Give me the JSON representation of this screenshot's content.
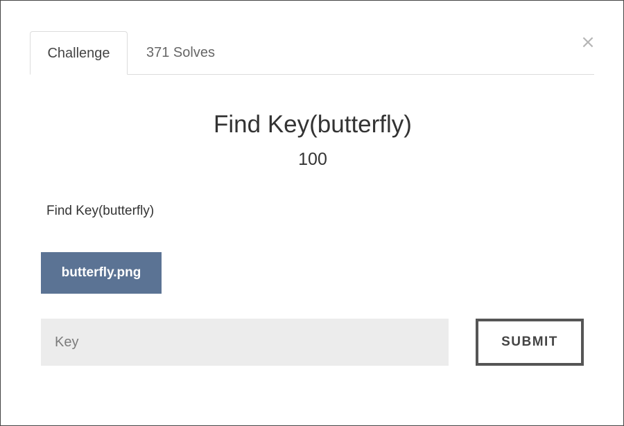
{
  "modal": {
    "close_symbol": "×"
  },
  "tabs": [
    {
      "label": "Challenge",
      "active": true
    },
    {
      "label": "371 Solves",
      "active": false
    }
  ],
  "challenge": {
    "title": "Find Key(butterfly)",
    "points": "100",
    "description": "Find Key(butterfly)",
    "file_label": "butterfly.png"
  },
  "form": {
    "key_placeholder": "Key",
    "key_value": "",
    "submit_label": "SUBMIT"
  },
  "colors": {
    "file_button_bg": "#5b7394",
    "input_bg": "#ececec",
    "submit_border": "#555555"
  }
}
